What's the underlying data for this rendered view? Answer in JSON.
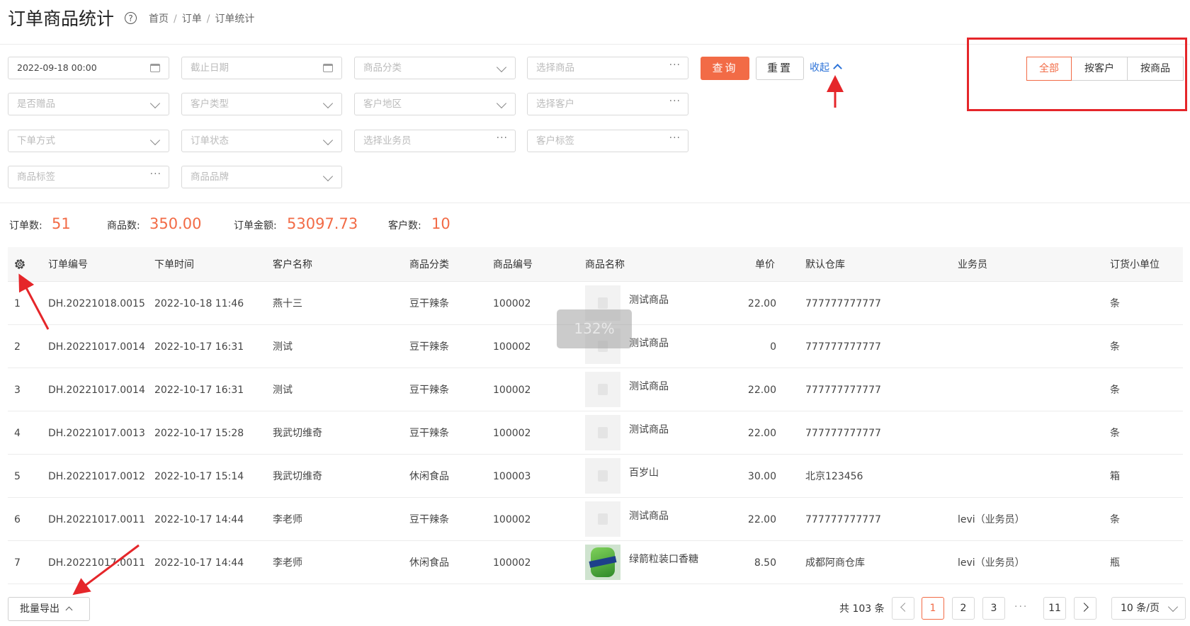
{
  "header": {
    "title": "订单商品统计",
    "help_glyph": "?",
    "breadcrumb": [
      "首页",
      "订单",
      "订单统计"
    ]
  },
  "filters": {
    "start_date": "2022-09-18 00:00",
    "end_date_placeholder": "截止日期",
    "product_category": "商品分类",
    "select_product": "选择商品",
    "is_gift": "是否赠品",
    "customer_type": "客户类型",
    "customer_region": "客户地区",
    "select_customer": "选择客户",
    "order_method": "下单方式",
    "order_status": "订单状态",
    "select_salesperson": "选择业务员",
    "customer_tag": "客户标签",
    "product_tag": "商品标签",
    "product_brand": "商品品牌",
    "query_label": "查询",
    "reset_label": "重置",
    "collapse_label": "收起"
  },
  "view_toggle": {
    "options": [
      "全部",
      "按客户",
      "按商品"
    ],
    "active": "全部"
  },
  "summary": {
    "order_count_label": "订单数:",
    "order_count": "51",
    "product_count_label": "商品数:",
    "product_count": "350.00",
    "order_amount_label": "订单金额:",
    "order_amount": "53097.73",
    "customer_count_label": "客户数:",
    "customer_count": "10"
  },
  "table": {
    "columns": [
      "订单编号",
      "下单时间",
      "客户名称",
      "商品分类",
      "商品编号",
      "商品名称",
      "单价",
      "默认仓库",
      "业务员",
      "订货小单位"
    ],
    "rows": [
      {
        "idx": "1",
        "order_no": "DH.20221018.0015",
        "time": "2022-10-18 11:46",
        "customer": "燕十三",
        "category": "豆干辣条",
        "code": "100002",
        "name": "测试商品",
        "price": "22.00",
        "warehouse": "777777777777",
        "salesperson": "",
        "unit": "条"
      },
      {
        "idx": "2",
        "order_no": "DH.20221017.0014",
        "time": "2022-10-17 16:31",
        "customer": "测试",
        "category": "豆干辣条",
        "code": "100002",
        "name": "测试商品",
        "price": "0",
        "warehouse": "777777777777",
        "salesperson": "",
        "unit": "条"
      },
      {
        "idx": "3",
        "order_no": "DH.20221017.0014",
        "time": "2022-10-17 16:31",
        "customer": "测试",
        "category": "豆干辣条",
        "code": "100002",
        "name": "测试商品",
        "price": "22.00",
        "warehouse": "777777777777",
        "salesperson": "",
        "unit": "条"
      },
      {
        "idx": "4",
        "order_no": "DH.20221017.0013",
        "time": "2022-10-17 15:28",
        "customer": "我武切维奇",
        "category": "豆干辣条",
        "code": "100002",
        "name": "测试商品",
        "price": "22.00",
        "warehouse": "777777777777",
        "salesperson": "",
        "unit": "条"
      },
      {
        "idx": "5",
        "order_no": "DH.20221017.0012",
        "time": "2022-10-17 15:14",
        "customer": "我武切维奇",
        "category": "休闲食品",
        "code": "100003",
        "name": "百岁山",
        "price": "30.00",
        "warehouse": "北京123456",
        "salesperson": "",
        "unit": "箱"
      },
      {
        "idx": "6",
        "order_no": "DH.20221017.0011",
        "time": "2022-10-17 14:44",
        "customer": "李老师",
        "category": "豆干辣条",
        "code": "100002",
        "name": "测试商品",
        "price": "22.00",
        "warehouse": "777777777777",
        "salesperson": "levi（业务员）",
        "unit": "条"
      },
      {
        "idx": "7",
        "order_no": "DH.20221017.0011",
        "time": "2022-10-17 14:44",
        "customer": "李老师",
        "category": "休闲食品",
        "code": "100002",
        "name": "绿箭粒装口香糖",
        "price": "8.50",
        "warehouse": "成都阿商仓库",
        "salesperson": "levi（业务员）",
        "unit": "瓶"
      }
    ]
  },
  "zoom_overlay": "132%",
  "footer": {
    "export_label": "批量导出",
    "total_text": "共 103 条",
    "pages": [
      "1",
      "2",
      "3",
      "11"
    ],
    "active_page": "1",
    "ellipsis": "···",
    "page_size": "10 条/页"
  },
  "colors": {
    "accent": "#f26b46",
    "link": "#2d73d8",
    "annotation_red": "#e5262a"
  }
}
